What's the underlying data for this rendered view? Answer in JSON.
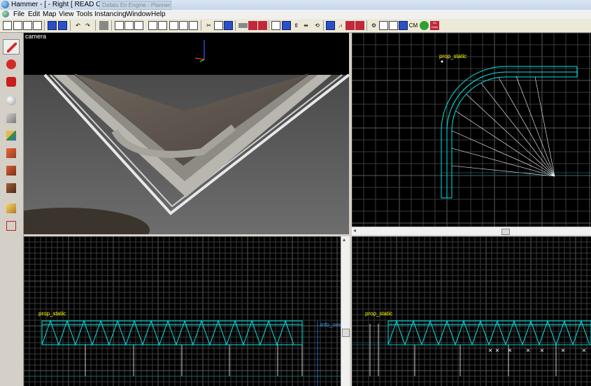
{
  "window": {
    "title": "Hammer - [ - Right [ READ ONLY ]]",
    "ghost_tab": "Dafatu En Engine - Planners"
  },
  "menu": [
    "File",
    "Edit",
    "Map",
    "View",
    "Tools",
    "Instancing",
    "Window",
    "Help"
  ],
  "toolbar": {
    "text_buttons": {
      "cm": "CM",
      "tl": "tl",
      "nodraw": "No Draw"
    }
  },
  "left_tools": [
    {
      "name": "selection-tool",
      "icon": "pointer-icon",
      "color": "#d32b2b"
    },
    {
      "name": "magnify-tool",
      "icon": "magnify-icon",
      "color": "#d32b2b"
    },
    {
      "name": "camera-tool",
      "icon": "camera-icon",
      "color": "#c81e1e"
    },
    {
      "name": "entity-tool",
      "icon": "entity-icon",
      "color": "#bdbdbd"
    },
    {
      "name": "block-tool",
      "icon": "block-icon",
      "color": "#9a9a9a"
    },
    {
      "name": "texture-tool",
      "icon": "texture-icon",
      "color": "#3b8f3b"
    },
    {
      "name": "apply-texture-tool",
      "icon": "apply-texture-icon",
      "color": "#c9602c"
    },
    {
      "name": "decal-tool",
      "icon": "decal-icon",
      "color": "#b04b22"
    },
    {
      "name": "overlay-tool",
      "icon": "overlay-icon",
      "color": "#7b4522"
    },
    {
      "name": "clipping-tool",
      "icon": "clip-icon",
      "color": "#e0b040"
    },
    {
      "name": "vertex-tool",
      "icon": "vertex-icon",
      "color": "#c02020"
    }
  ],
  "viewports": {
    "camera": {
      "label": "camera"
    },
    "top": {
      "entity_label": "prop_static"
    },
    "bottom_left": {
      "entity_label": "prop_static",
      "entity_label_2": "info_ove"
    },
    "bottom_right": {
      "entity_label": "prop_static"
    }
  },
  "colors": {
    "wire": "#00e5e5",
    "grid": "#3a3a3a",
    "grid_major": "#5a5a5a",
    "entity_text": "#ffff00"
  }
}
